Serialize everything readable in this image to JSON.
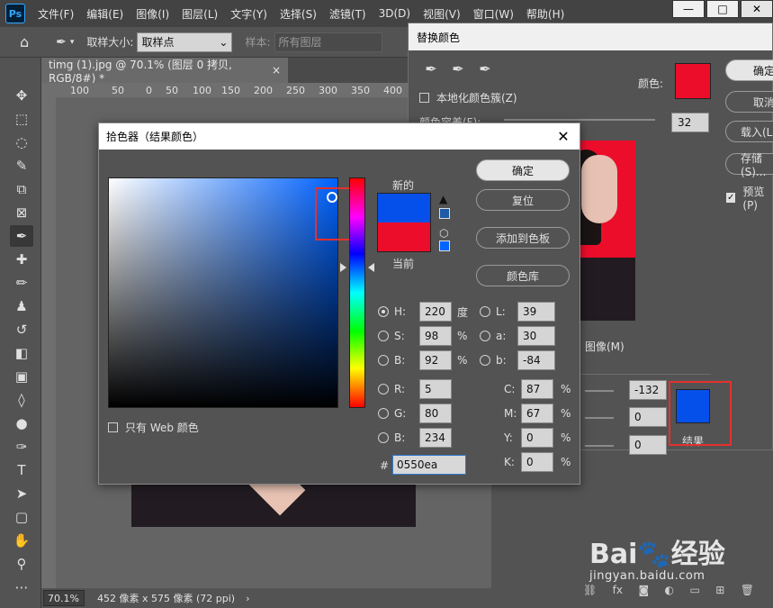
{
  "app": {
    "logo": "Ps",
    "menu": [
      "文件(F)",
      "编辑(E)",
      "图像(I)",
      "图层(L)",
      "文字(Y)",
      "选择(S)",
      "滤镜(T)",
      "3D(D)",
      "视图(V)",
      "窗口(W)",
      "帮助(H)"
    ],
    "window_controls": [
      "—",
      "□",
      "✕"
    ]
  },
  "options_bar": {
    "sample_size_label": "取样大小:",
    "sample_size_value": "取样点",
    "sample_label": "样本:",
    "sample_value": "所有图层"
  },
  "document": {
    "tab_title": "timg (1).jpg @ 70.1% (图层 0 拷贝, RGB/8#) *",
    "tab_close": "×",
    "ruler_ticks": [
      "100",
      "50",
      "0",
      "50",
      "100",
      "150",
      "200",
      "250",
      "300",
      "350",
      "400"
    ]
  },
  "status_bar": {
    "zoom": "70.1%",
    "dimensions": "452 像素 x 575 像素 (72 ppi)",
    "arrow": "›"
  },
  "replace_color": {
    "title": "替换颜色",
    "color_label": "颜色:",
    "color_hex": "#ec0d2b",
    "localized_clusters_label": "本地化颜色簇(Z)",
    "fuzziness_label": "颜色容差(F):",
    "fuzziness_value": "32",
    "buttons": [
      "确定",
      "取消",
      "载入(L)...",
      "存储(S)..."
    ],
    "preview_label": "预览(P)",
    "image_label": "图像(M)",
    "hue_value": "-132",
    "saturation_value": "0",
    "lightness_value": "0",
    "result_label": "结果",
    "result_hex": "#0550ea"
  },
  "color_picker": {
    "title": "拾色器（结果颜色）",
    "close": "✕",
    "new_label": "新的",
    "current_label": "当前",
    "new_hex": "#0550ea",
    "current_hex": "#ec0d2b",
    "buttons": {
      "ok": "确定",
      "reset": "复位",
      "add_swatch": "添加到色板",
      "libraries": "颜色库"
    },
    "web_only_label": "只有 Web 颜色",
    "fields_left": [
      {
        "label": "H:",
        "value": "220",
        "unit": "度",
        "selected": true
      },
      {
        "label": "S:",
        "value": "98",
        "unit": "%",
        "selected": false
      },
      {
        "label": "B:",
        "value": "92",
        "unit": "%",
        "selected": false
      },
      {
        "label": "R:",
        "value": "5",
        "unit": "",
        "selected": false
      },
      {
        "label": "G:",
        "value": "80",
        "unit": "",
        "selected": false
      },
      {
        "label": "B:",
        "value": "234",
        "unit": "",
        "selected": false
      }
    ],
    "fields_lab": [
      {
        "label": "L:",
        "value": "39"
      },
      {
        "label": "a:",
        "value": "30"
      },
      {
        "label": "b:",
        "value": "-84"
      }
    ],
    "fields_cmyk": [
      {
        "label": "C:",
        "value": "87",
        "unit": "%"
      },
      {
        "label": "M:",
        "value": "67",
        "unit": "%"
      },
      {
        "label": "Y:",
        "value": "0",
        "unit": "%"
      },
      {
        "label": "K:",
        "value": "0",
        "unit": "%"
      }
    ],
    "hex_label": "#",
    "hex_value": "0550ea"
  },
  "watermark": {
    "brand": "Bai🐾经验",
    "url": "jingyan.baidu.com"
  }
}
